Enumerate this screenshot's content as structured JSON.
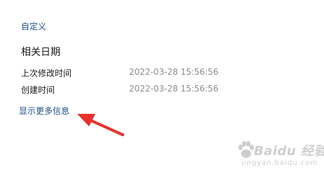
{
  "customize_link": "自定义",
  "related_dates": {
    "title": "相关日期",
    "rows": [
      {
        "label": "上次修改时间",
        "value": "2022-03-28 15:56:56"
      },
      {
        "label": "创建时间",
        "value": "2022-03-28 15:56:56"
      }
    ]
  },
  "more_info_link": "显示更多信息",
  "annotation": {
    "color": "#e8322b"
  },
  "watermark": {
    "text": "Baidu 经验",
    "sub": "jingyan.baidu.com"
  },
  "colors": {
    "link": "#1b4f8a",
    "label": "#1a1a1a",
    "value": "#8c8c8c"
  }
}
